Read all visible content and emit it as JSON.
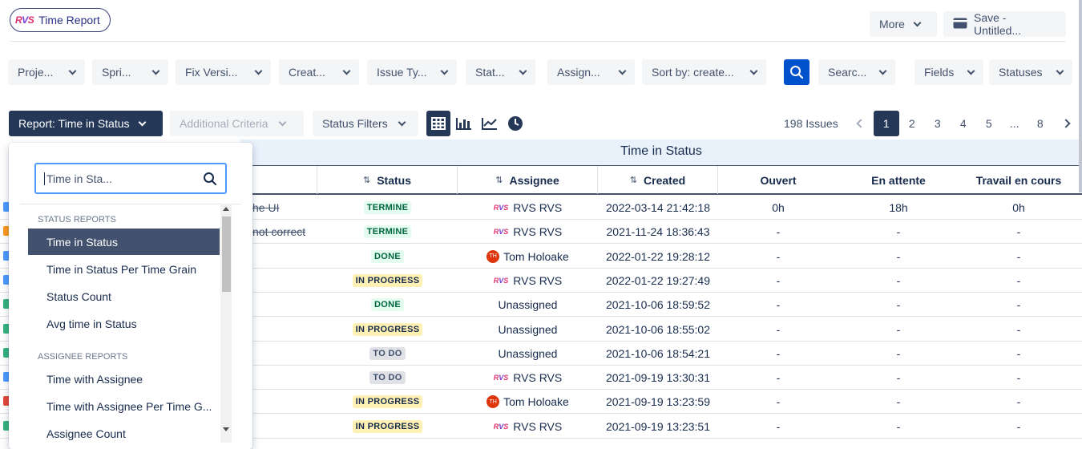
{
  "app": {
    "title": "Time Report",
    "logo": "RVS"
  },
  "top_actions": {
    "more": "More",
    "save": "Save - Untitled..."
  },
  "filters": [
    {
      "label": "Proje..."
    },
    {
      "label": "Spri..."
    },
    {
      "label": "Fix Versi..."
    },
    {
      "label": "Creat..."
    },
    {
      "label": "Issue Ty..."
    },
    {
      "label": "Stat..."
    },
    {
      "label": "Assign..."
    },
    {
      "label": "Sort by: create..."
    }
  ],
  "search_filter": "Searc...",
  "fields": "Fields",
  "statuses": "Statuses",
  "report": {
    "button": "Report: Time in Status",
    "additional": "Additional Criteria",
    "status_filters": "Status Filters"
  },
  "pagination": {
    "count": "198 Issues",
    "pages": [
      "1",
      "2",
      "3",
      "4",
      "5",
      "...",
      "8"
    ],
    "current": "1"
  },
  "table": {
    "group": "Time in Status",
    "columns": {
      "status": "Status",
      "assignee": "Assignee",
      "created": "Created",
      "ouvert": "Ouvert",
      "en_attente": "En attente",
      "travail": "Travail en cours"
    },
    "rows": [
      {
        "summary_tail": "he UI",
        "status": "TERMINE",
        "assignee": "RVS RVS",
        "avatar": "rvs",
        "created": "2022-03-14 21:42:18",
        "ouvert": "0h",
        "en_attente": "18h",
        "travail": "0h",
        "type_color": "#4c9aff"
      },
      {
        "summary_tail": "not correct",
        "status": "TERMINE",
        "assignee": "RVS RVS",
        "avatar": "rvs",
        "created": "2021-11-24 18:36:43",
        "ouvert": "-",
        "en_attente": "-",
        "travail": "-",
        "type_color": "#ff991f"
      },
      {
        "summary_tail": "",
        "status": "DONE",
        "assignee": "Tom Holoake",
        "avatar": "th",
        "created": "2022-01-22 19:28:12",
        "ouvert": "-",
        "en_attente": "-",
        "travail": "-",
        "type_color": "#4c9aff"
      },
      {
        "summary_tail": "",
        "status": "IN PROGRESS",
        "assignee": "RVS RVS",
        "avatar": "rvs",
        "created": "2022-01-22 19:27:49",
        "ouvert": "-",
        "en_attente": "-",
        "travail": "-",
        "type_color": "#4c9aff"
      },
      {
        "summary_tail": "",
        "status": "DONE",
        "assignee": "Unassigned",
        "avatar": "",
        "created": "2021-10-06 18:59:52",
        "ouvert": "-",
        "en_attente": "-",
        "travail": "-",
        "type_color": "#36b37e"
      },
      {
        "summary_tail": "",
        "status": "IN PROGRESS",
        "assignee": "Unassigned",
        "avatar": "",
        "created": "2021-10-06 18:55:02",
        "ouvert": "-",
        "en_attente": "-",
        "travail": "-",
        "type_color": "#36b37e"
      },
      {
        "summary_tail": "",
        "status": "TO DO",
        "assignee": "Unassigned",
        "avatar": "",
        "created": "2021-10-06 18:54:21",
        "ouvert": "-",
        "en_attente": "-",
        "travail": "-",
        "type_color": "#36b37e"
      },
      {
        "summary_tail": "",
        "status": "TO DO",
        "assignee": "RVS RVS",
        "avatar": "rvs",
        "created": "2021-09-19 13:30:31",
        "ouvert": "-",
        "en_attente": "-",
        "travail": "-",
        "type_color": "#4c9aff"
      },
      {
        "summary_tail": "",
        "status": "IN PROGRESS",
        "assignee": "Tom Holoake",
        "avatar": "th",
        "created": "2021-09-19 13:23:59",
        "ouvert": "-",
        "en_attente": "-",
        "travail": "-",
        "type_color": "#e5493a"
      },
      {
        "summary_tail": "",
        "status": "IN PROGRESS",
        "assignee": "RVS RVS",
        "avatar": "rvs",
        "created": "2021-09-19 13:23:51",
        "ouvert": "-",
        "en_attente": "-",
        "travail": "-",
        "type_color": "#36b37e"
      }
    ]
  },
  "dropdown": {
    "search_value": "Time in Sta...",
    "status_section": "STATUS REPORTS",
    "status_items": [
      "Time in Status",
      "Time in Status Per Time Grain",
      "Status Count",
      "Avg time in Status"
    ],
    "assignee_section": "ASSIGNEE REPORTS",
    "assignee_items": [
      "Time with Assignee",
      "Time with Assignee Per Time G...",
      "Assignee Count"
    ],
    "selected": "Time in Status"
  }
}
